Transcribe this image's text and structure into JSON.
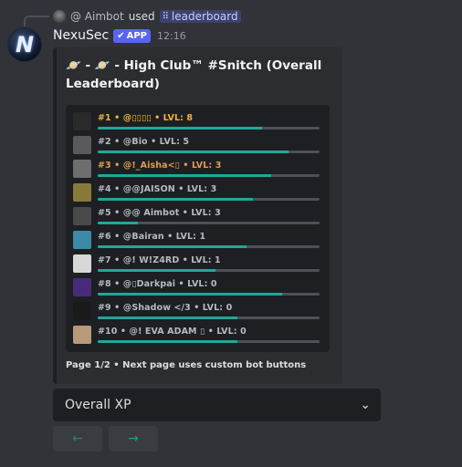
{
  "reply": {
    "bot_name": "@ Aimbot",
    "used_text": "used",
    "command": "leaderboard",
    "command_icon": "grid-icon"
  },
  "message": {
    "username": "NexuSec",
    "app_badge": "APP",
    "timestamp": "12:16"
  },
  "embed": {
    "title": "🪐 - 🪐 -  High Club™  #Snitch (Overall Leaderboard)",
    "footer": "Page 1/2 • Next page uses custom bot buttons",
    "rows": [
      {
        "text": "#1 • @▯▯▯▯ • LVL: 8",
        "progress": 0.74,
        "color": "gold",
        "pic": "#2a2a2a"
      },
      {
        "text": "#2 • @Bio • LVL: 5",
        "progress": 0.86,
        "color": "",
        "pic": "#5a5a5a"
      },
      {
        "text": "#3 • @!_Aisha<▯ • LVL: 3",
        "progress": 0.78,
        "color": "orange",
        "pic": "#6e6e6e"
      },
      {
        "text": "#4 • @@JAISON • LVL: 3",
        "progress": 0.7,
        "color": "",
        "pic": "#8a7a3a"
      },
      {
        "text": "#5 • @@ Aimbot • LVL: 3",
        "progress": 0.18,
        "color": "",
        "pic": "#4a4a4a"
      },
      {
        "text": "#6 • @Bairan • LVL: 1",
        "progress": 0.67,
        "color": "",
        "pic": "#3a8aa8"
      },
      {
        "text": "#7 • @!       W!Z4RD • LVL: 1",
        "progress": 0.53,
        "color": "",
        "pic": "#d8d8d8"
      },
      {
        "text": "#8 • @▯Darkpai • LVL: 0",
        "progress": 0.83,
        "color": "",
        "pic": "#4a2a7a"
      },
      {
        "text": "#9 • @Shadow </3 • LVL: 0",
        "progress": 0.63,
        "color": "",
        "pic": "#1a1a1a"
      },
      {
        "text": "#10 • @!      EVA ADAM    ▯ • LVL: 0",
        "progress": 0.63,
        "color": "",
        "pic": "#b89a78"
      }
    ]
  },
  "select": {
    "value": "Overall XP",
    "icon": "chevron-down-icon"
  },
  "buttons": {
    "prev_label": "←",
    "next_label": "→"
  },
  "colors": {
    "background": "#313338",
    "embed": "#2b2d31",
    "progress_fill": "#1fa89c",
    "app_badge": "#5865f2",
    "gold_text": "#f0b232",
    "orange_text": "#e39b4b"
  }
}
